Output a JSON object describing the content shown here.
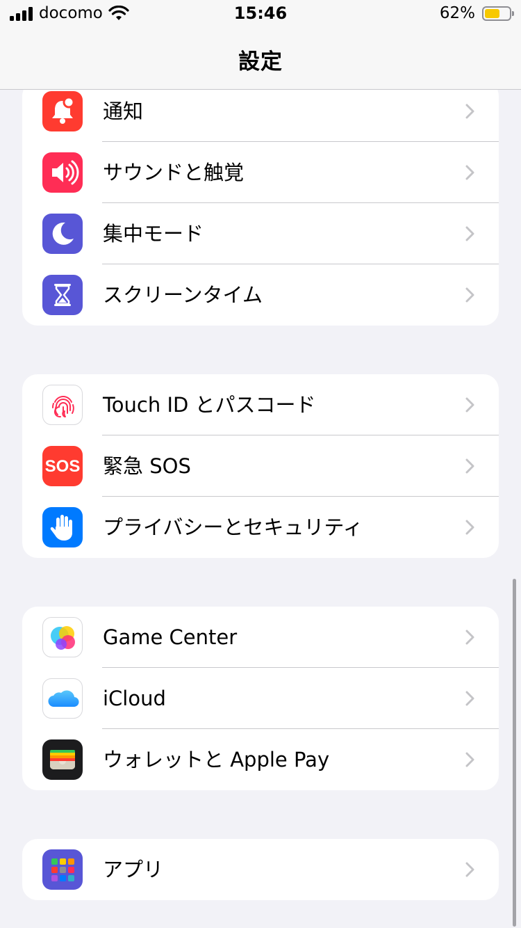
{
  "status_bar": {
    "carrier": "docomo",
    "time": "15:46",
    "battery_percent": "62%",
    "battery_level": 0.62,
    "battery_color": "#f7c900"
  },
  "nav": {
    "title": "設定"
  },
  "groups": [
    {
      "items": [
        {
          "label": "通知",
          "icon": "notifications-icon",
          "color": "#ff3b30"
        },
        {
          "label": "サウンドと触覚",
          "icon": "sound-icon",
          "color": "#ff2d55"
        },
        {
          "label": "集中モード",
          "icon": "moon-icon",
          "color": "#5856d6"
        },
        {
          "label": "スクリーンタイム",
          "icon": "hourglass-icon",
          "color": "#5856d6"
        }
      ]
    },
    {
      "items": [
        {
          "label": "Touch ID とパスコード",
          "icon": "fingerprint-icon",
          "color": "#ffffff"
        },
        {
          "label": "緊急 SOS",
          "icon": "sos-icon",
          "color": "#ff3b30",
          "icon_text": "SOS"
        },
        {
          "label": "プライバシーとセキュリティ",
          "icon": "hand-icon",
          "color": "#007aff"
        }
      ]
    },
    {
      "items": [
        {
          "label": "Game Center",
          "icon": "game-center-icon",
          "color": "#ffffff"
        },
        {
          "label": "iCloud",
          "icon": "icloud-icon",
          "color": "#ffffff"
        },
        {
          "label": "ウォレットと Apple Pay",
          "icon": "wallet-icon",
          "color": "#1c1c1e"
        }
      ]
    },
    {
      "items": [
        {
          "label": "アプリ",
          "icon": "apps-grid-icon",
          "color": "#5856d6"
        }
      ]
    }
  ]
}
